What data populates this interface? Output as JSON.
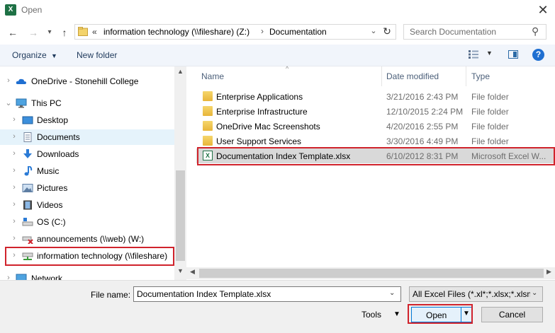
{
  "window": {
    "title": "Open",
    "app_icon": "excel-icon"
  },
  "nav": {
    "back": "back-arrow-icon",
    "forward": "forward-arrow-icon",
    "up": "up-arrow-icon"
  },
  "address": {
    "chevron": "«",
    "segments": [
      "information technology (\\\\fileshare) (Z:)",
      "Documentation"
    ]
  },
  "search": {
    "placeholder": "Search Documentation"
  },
  "toolbar": {
    "organize_label": "Organize",
    "new_folder_label": "New folder",
    "help_label": "?"
  },
  "sidebar": {
    "items": [
      {
        "label": "OneDrive - Stonehill College",
        "icon": "cloud-icon"
      },
      {
        "label": "This PC",
        "icon": "computer-icon"
      },
      {
        "label": "Desktop",
        "icon": "desktop-icon"
      },
      {
        "label": "Documents",
        "icon": "documents-icon"
      },
      {
        "label": "Downloads",
        "icon": "downloads-icon"
      },
      {
        "label": "Music",
        "icon": "music-icon"
      },
      {
        "label": "Pictures",
        "icon": "pictures-icon"
      },
      {
        "label": "Videos",
        "icon": "videos-icon"
      },
      {
        "label": "OS (C:)",
        "icon": "drive-icon"
      },
      {
        "label": "announcements (\\\\web) (W:)",
        "icon": "disconnected-drive-icon"
      },
      {
        "label": "information technology (\\\\fileshare)",
        "icon": "network-drive-icon"
      },
      {
        "label": "Network",
        "icon": "network-icon"
      }
    ]
  },
  "files": {
    "columns": [
      "Name",
      "Date modified",
      "Type"
    ],
    "rows": [
      {
        "name": "Enterprise Applications",
        "date": "3/21/2016 2:43 PM",
        "type": "File folder",
        "icon": "folder-icon"
      },
      {
        "name": "Enterprise Infrastructure",
        "date": "12/10/2015 2:24 PM",
        "type": "File folder",
        "icon": "folder-icon"
      },
      {
        "name": "OneDrive Mac Screenshots",
        "date": "4/20/2016 2:55 PM",
        "type": "File folder",
        "icon": "folder-icon"
      },
      {
        "name": "User Support Services",
        "date": "3/30/2016 4:49 PM",
        "type": "File folder",
        "icon": "folder-icon"
      },
      {
        "name": "Documentation Index Template.xlsx",
        "date": "6/10/2012 8:31 PM",
        "type": "Microsoft Excel W...",
        "icon": "excel-file-icon"
      }
    ]
  },
  "bottom": {
    "file_name_label": "File name:",
    "file_name_value": "Documentation Index Template.xlsx",
    "filter_value": "All Excel Files (*.xl*;*.xlsx;*.xlsm;",
    "tools_label": "Tools",
    "open_label": "Open",
    "cancel_label": "Cancel"
  },
  "colors": {
    "highlight": "#d0232c",
    "accent": "#0078d7",
    "toolbar_bg": "#f1f5fb",
    "selection": "#e5f3fb"
  }
}
